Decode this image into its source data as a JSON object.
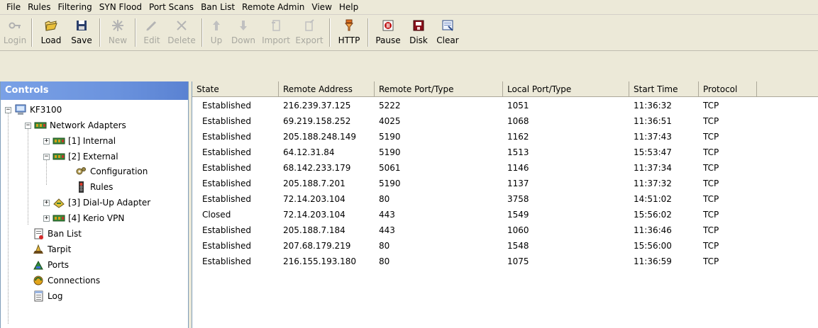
{
  "menu": [
    "File",
    "Rules",
    "Filtering",
    "SYN Flood",
    "Port Scans",
    "Ban List",
    "Remote Admin",
    "View",
    "Help"
  ],
  "toolbar": {
    "login": "Login",
    "load": "Load",
    "save": "Save",
    "new": "New",
    "edit": "Edit",
    "delete": "Delete",
    "up": "Up",
    "down": "Down",
    "import": "Import",
    "export": "Export",
    "http": "HTTP",
    "pause": "Pause",
    "disk": "Disk",
    "clear": "Clear"
  },
  "controls": {
    "title": "Controls",
    "tree": {
      "root": "KF3100",
      "network_adapters": "Network Adapters",
      "internal": "[1] Internal",
      "external": "[2] External",
      "configuration": "Configuration",
      "rules": "Rules",
      "dialup": "[3] Dial-Up Adapter",
      "vpn": "[4] Kerio VPN",
      "ban_list": "Ban List",
      "tarpit": "Tarpit",
      "ports": "Ports",
      "connections": "Connections",
      "log": "Log"
    }
  },
  "table": {
    "headers": [
      "State",
      "Remote Address",
      "Remote Port/Type",
      "Local Port/Type",
      "Start Time",
      "Protocol"
    ],
    "rows": [
      [
        "Established",
        "216.239.37.125",
        "5222",
        "1051",
        "11:36:32",
        "TCP"
      ],
      [
        "Established",
        "69.219.158.252",
        "4025",
        "1068",
        "11:36:51",
        "TCP"
      ],
      [
        "Established",
        "205.188.248.149",
        "5190",
        "1162",
        "11:37:43",
        "TCP"
      ],
      [
        "Established",
        "64.12.31.84",
        "5190",
        "1513",
        "15:53:47",
        "TCP"
      ],
      [
        "Established",
        "68.142.233.179",
        "5061",
        "1146",
        "11:37:34",
        "TCP"
      ],
      [
        "Established",
        "205.188.7.201",
        "5190",
        "1137",
        "11:37:32",
        "TCP"
      ],
      [
        "Established",
        "72.14.203.104",
        "80",
        "3758",
        "14:51:02",
        "TCP"
      ],
      [
        "Closed",
        "72.14.203.104",
        "443",
        "1549",
        "15:56:02",
        "TCP"
      ],
      [
        "Established",
        "205.188.7.184",
        "443",
        "1060",
        "11:36:46",
        "TCP"
      ],
      [
        "Established",
        "207.68.179.219",
        "80",
        "1548",
        "15:56:00",
        "TCP"
      ],
      [
        "Established",
        "216.155.193.180",
        "80",
        "1075",
        "11:36:59",
        "TCP"
      ]
    ]
  }
}
